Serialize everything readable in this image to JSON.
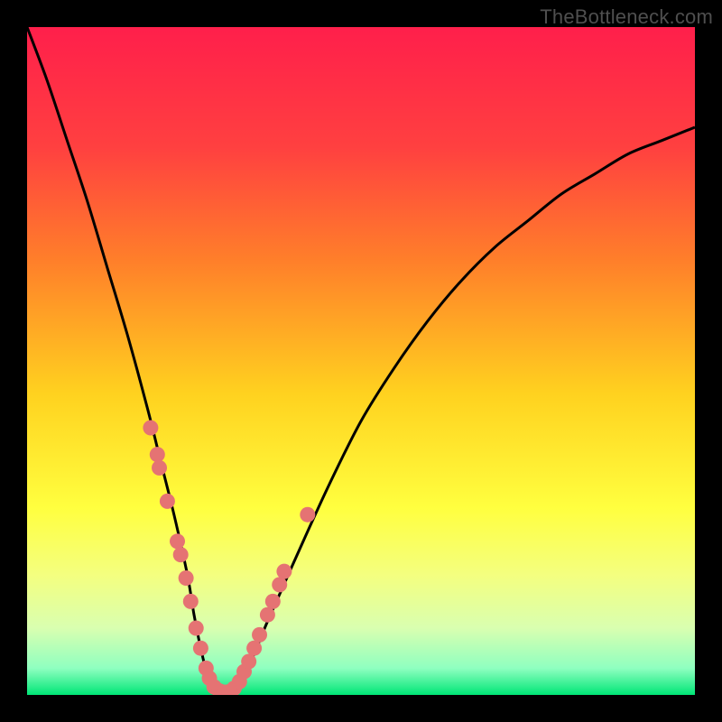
{
  "watermark": "TheBottleneck.com",
  "colors": {
    "frame": "#000000",
    "gradient_stops": [
      {
        "offset": 0.0,
        "color": "#ff1f4b"
      },
      {
        "offset": 0.18,
        "color": "#ff4040"
      },
      {
        "offset": 0.35,
        "color": "#ff7f2a"
      },
      {
        "offset": 0.55,
        "color": "#ffd21f"
      },
      {
        "offset": 0.72,
        "color": "#ffff3f"
      },
      {
        "offset": 0.82,
        "color": "#f4ff7f"
      },
      {
        "offset": 0.9,
        "color": "#d9ffb0"
      },
      {
        "offset": 0.96,
        "color": "#8fffc0"
      },
      {
        "offset": 1.0,
        "color": "#00e676"
      }
    ],
    "curve": "#000000",
    "dots": "#e57373"
  },
  "chart_data": {
    "type": "line",
    "title": "",
    "xlabel": "",
    "ylabel": "",
    "xlim": [
      0,
      100
    ],
    "ylim": [
      0,
      100
    ],
    "grid": false,
    "series": [
      {
        "name": "bottleneck-curve",
        "x": [
          0,
          3,
          6,
          9,
          12,
          15,
          18,
          20,
          22,
          24,
          25,
          26,
          27,
          28,
          30,
          33,
          36,
          40,
          45,
          50,
          55,
          60,
          65,
          70,
          75,
          80,
          85,
          90,
          95,
          100
        ],
        "y": [
          100,
          92,
          83,
          74,
          64,
          54,
          43,
          35,
          27,
          18,
          12,
          7,
          3,
          1,
          0,
          4,
          11,
          20,
          31,
          41,
          49,
          56,
          62,
          67,
          71,
          75,
          78,
          81,
          83,
          85
        ]
      }
    ],
    "markers": [
      {
        "x": 18.5,
        "y": 40.0
      },
      {
        "x": 19.5,
        "y": 36.0
      },
      {
        "x": 19.8,
        "y": 34.0
      },
      {
        "x": 21.0,
        "y": 29.0
      },
      {
        "x": 22.5,
        "y": 23.0
      },
      {
        "x": 23.0,
        "y": 21.0
      },
      {
        "x": 23.8,
        "y": 17.5
      },
      {
        "x": 24.5,
        "y": 14.0
      },
      {
        "x": 25.3,
        "y": 10.0
      },
      {
        "x": 26.0,
        "y": 7.0
      },
      {
        "x": 26.8,
        "y": 4.0
      },
      {
        "x": 27.3,
        "y": 2.5
      },
      {
        "x": 28.0,
        "y": 1.2
      },
      {
        "x": 28.8,
        "y": 0.6
      },
      {
        "x": 29.5,
        "y": 0.4
      },
      {
        "x": 30.3,
        "y": 0.5
      },
      {
        "x": 31.0,
        "y": 1.0
      },
      {
        "x": 31.8,
        "y": 2.0
      },
      {
        "x": 32.5,
        "y": 3.5
      },
      {
        "x": 33.2,
        "y": 5.0
      },
      {
        "x": 34.0,
        "y": 7.0
      },
      {
        "x": 34.8,
        "y": 9.0
      },
      {
        "x": 36.0,
        "y": 12.0
      },
      {
        "x": 36.8,
        "y": 14.0
      },
      {
        "x": 37.8,
        "y": 16.5
      },
      {
        "x": 38.5,
        "y": 18.5
      },
      {
        "x": 42.0,
        "y": 27.0
      }
    ]
  }
}
